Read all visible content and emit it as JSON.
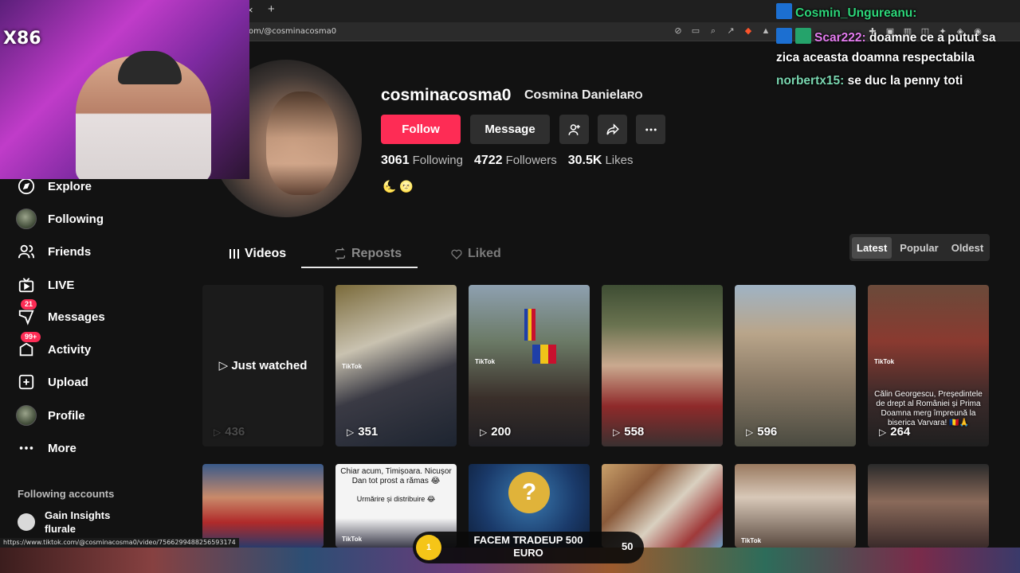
{
  "browser": {
    "url": "om/@cosminacosma0",
    "status_url": "https://www.tiktok.com/@cosminacosma0/video/7566299488256593174",
    "close_tab_glyph": "×",
    "new_tab_glyph": "+"
  },
  "sidebar": {
    "items": [
      {
        "label": "Explore",
        "icon": "compass-icon"
      },
      {
        "label": "Following",
        "icon": "avatar"
      },
      {
        "label": "Friends",
        "icon": "friends-icon"
      },
      {
        "label": "LIVE",
        "icon": "live-icon"
      },
      {
        "label": "Messages",
        "icon": "messages-icon",
        "badge": "21"
      },
      {
        "label": "Activity",
        "icon": "activity-icon",
        "badge": "99+"
      },
      {
        "label": "Upload",
        "icon": "upload-icon"
      },
      {
        "label": "Profile",
        "icon": "avatar"
      },
      {
        "label": "More",
        "icon": "more-icon"
      }
    ],
    "following_title": "Following accounts",
    "following_accounts": [
      {
        "name_line1": "Gain Insights",
        "name_line2": "flurale"
      }
    ]
  },
  "profile": {
    "username": "cosminacosma0",
    "display_name": "Cosmina Daniela",
    "display_name_suffix": "RO",
    "follow_label": "Follow",
    "message_label": "Message",
    "stats": [
      {
        "value": "3061",
        "label": "Following"
      },
      {
        "value": "4722",
        "label": "Followers"
      },
      {
        "value": "30.5K",
        "label": "Likes"
      }
    ],
    "bio": "🌜 🌝"
  },
  "tabs": [
    {
      "label": "Videos",
      "state": "active"
    },
    {
      "label": "Reposts",
      "state": "hover"
    },
    {
      "label": "Liked",
      "state": "dim"
    }
  ],
  "sort": {
    "options": [
      "Latest",
      "Popular",
      "Oldest"
    ],
    "selected": "Latest"
  },
  "videos_row1": [
    {
      "views": "436",
      "overlay": "Just watched"
    },
    {
      "views": "351",
      "caption": ""
    },
    {
      "views": "200",
      "caption": ""
    },
    {
      "views": "558",
      "caption": ""
    },
    {
      "views": "596",
      "caption": ""
    },
    {
      "views": "264",
      "caption": "Călin Georgescu, Președintele de drept al României și Prima Doamna merg împreună la biserica Varvara! 🇷🇴🙏"
    }
  ],
  "videos_row2": [
    {
      "caption": ""
    },
    {
      "caption": "Chiar acum, Timișoara. Nicușor Dan tot prost a rămas 😂",
      "subcaption": "Urmărire și distribuire 😂"
    },
    {
      "caption": ""
    },
    {
      "caption": ""
    },
    {
      "caption": ""
    },
    {
      "caption": ""
    }
  ],
  "tiktok_watermark": "TikTok",
  "stream": {
    "webcam_logo": "X86",
    "chat": [
      {
        "user": "Cosmin_Ungureanu:",
        "message": ""
      },
      {
        "user": "Scar222:",
        "message": "doamne ce a putut sa zica aceasta doamna respectabila"
      },
      {
        "user": "norbertx15:",
        "message": "se duc la penny toti"
      }
    ],
    "promo": {
      "coin": "1",
      "text_line1": "FACEM TRADEUP 500",
      "text_line2": "EURO",
      "count": "50"
    }
  },
  "colors": {
    "brand_red": "#fe2c55",
    "background": "#121212"
  }
}
